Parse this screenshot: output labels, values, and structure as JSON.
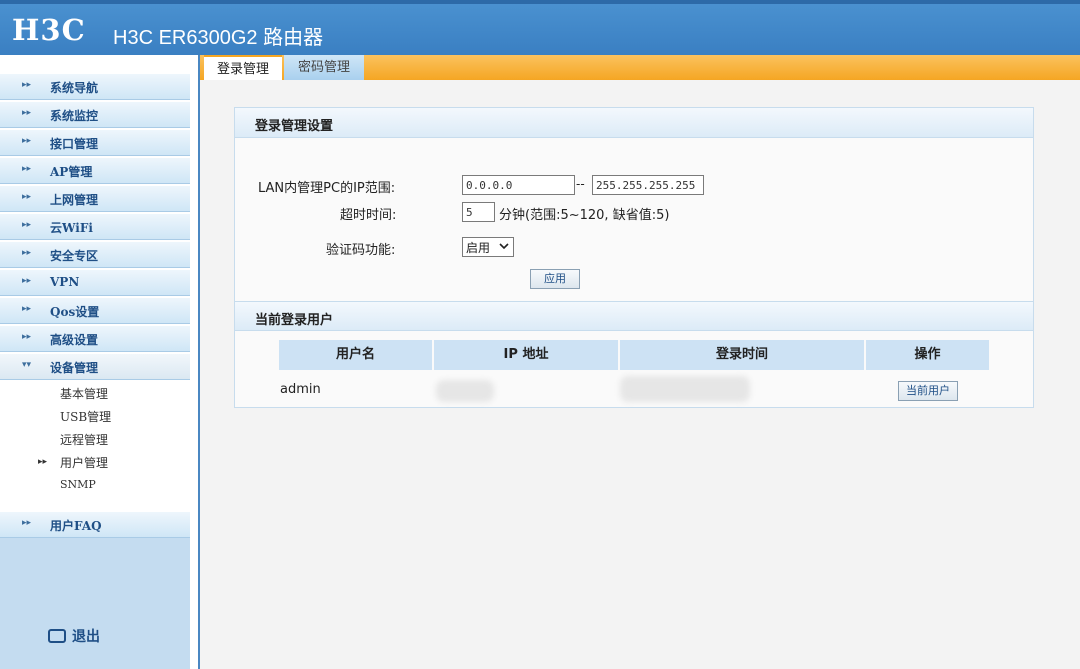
{
  "header": {
    "logo": "H3C",
    "title": "H3C ER6300G2 路由器"
  },
  "sidebar": {
    "items": [
      {
        "label": "系统导航"
      },
      {
        "label": "系统监控"
      },
      {
        "label": "接口管理"
      },
      {
        "label": "AP管理"
      },
      {
        "label": "上网管理"
      },
      {
        "label": "云WiFi"
      },
      {
        "label": "安全专区"
      },
      {
        "label": "VPN"
      },
      {
        "label": "Qos设置"
      },
      {
        "label": "高级设置"
      },
      {
        "label": "设备管理"
      }
    ],
    "sub_items": [
      {
        "label": "基本管理"
      },
      {
        "label": "USB管理"
      },
      {
        "label": "远程管理"
      },
      {
        "label": "用户管理"
      },
      {
        "label": "SNMP"
      }
    ],
    "faq": "用户FAQ",
    "logout": "退出"
  },
  "tabs": [
    {
      "label": "登录管理"
    },
    {
      "label": "密码管理"
    }
  ],
  "login_settings": {
    "heading": "登录管理设置",
    "lan_label": "LAN内管理PC的IP范围:",
    "ip_start": "0.0.0.0",
    "ip_sep": "--",
    "ip_end": "255.255.255.255",
    "timeout_label": "超时时间:",
    "timeout_value": "5",
    "timeout_hint": "分钟(范围:5~120, 缺省值:5)",
    "captcha_label": "验证码功能:",
    "captcha_value": "启用",
    "apply_button": "应用"
  },
  "current_users": {
    "heading": "当前登录用户",
    "columns": [
      "用户名",
      "IP 地址",
      "登录时间",
      "操作"
    ],
    "rows": [
      {
        "username": "admin",
        "action": "当前用户"
      }
    ]
  }
}
